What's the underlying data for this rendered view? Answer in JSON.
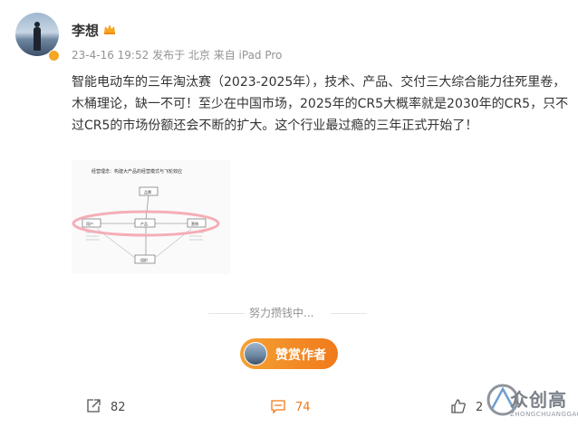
{
  "author": {
    "name": "李想",
    "timestamp": "23-4-16 19:52",
    "location": "发布于 北京",
    "device": "来自 iPad Pro"
  },
  "post": {
    "text": "智能电动车的三年淘汰赛（2023-2025年），技术、产品、交付三大综合能力往死里卷，木桶理论，缺一不可！至少在中国市场，2025年的CR5大概率就是2030年的CR5，只不过CR5的市场份额还会不断的扩大。这个行业最过瘾的三年正式开始了！"
  },
  "image_diagram": {
    "title": "经营理念：构建大产品的经营模式与飞轮效应",
    "nodes": [
      "品牌",
      "用户",
      "产品",
      "营销",
      "组织"
    ]
  },
  "progress": {
    "label": "努力攒钱中..."
  },
  "reward": {
    "label": "赞赏作者"
  },
  "actions": {
    "repost_count": "82",
    "comment_count": "74",
    "like_count": "2"
  },
  "watermark": {
    "brand": "众创高",
    "sub": "ZHONGCHUANGGAO"
  }
}
